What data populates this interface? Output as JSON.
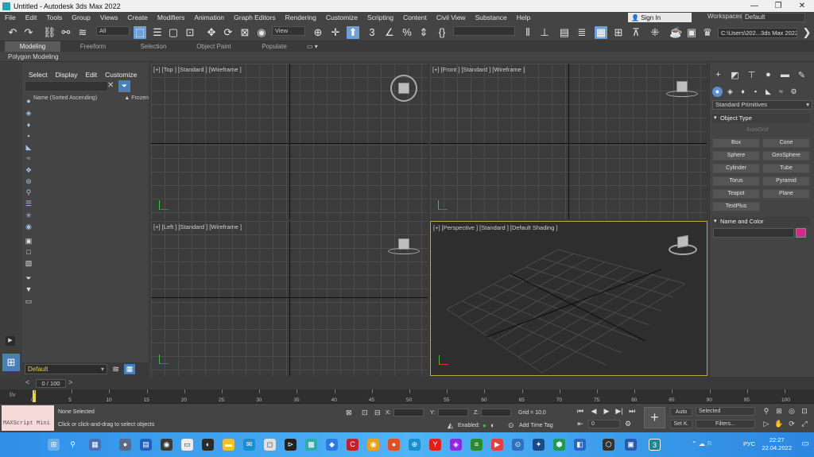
{
  "window": {
    "title": "Untitled - Autodesk 3ds Max 2022",
    "minimize": "—",
    "restore": "❐",
    "close": "✕"
  },
  "menu": [
    "File",
    "Edit",
    "Tools",
    "Group",
    "Views",
    "Create",
    "Modifiers",
    "Animation",
    "Graph Editors",
    "Rendering",
    "Customize",
    "Scripting",
    "Content",
    "Civil View",
    "Substance",
    "Help"
  ],
  "account": {
    "signin": "Sign In",
    "workspaces_label": "Workspaces:",
    "workspace": "Default"
  },
  "toolbar": {
    "selection_filter": "All",
    "ref_coord": "View",
    "project_path": "C:\\Users\\202...3ds Max 2022"
  },
  "ribbon": {
    "tabs": [
      "Modeling",
      "Freeform",
      "Selection",
      "Object Paint",
      "Populate"
    ],
    "active_tab": "Modeling",
    "sub": "Polygon Modeling"
  },
  "scene_explorer": {
    "menus": [
      "Select",
      "Display",
      "Edit",
      "Customize"
    ],
    "col_name": "Name (Sorted Ascending)",
    "col_frozen": "▲ Frozen"
  },
  "layer": "Default",
  "viewports": {
    "top": "[+] [Top ] [Standard ] [Wireframe ]",
    "front": "[+] [Front ] [Standard ] [Wireframe ]",
    "left": "[+] [Left ] [Standard ] [Wireframe ]",
    "perspective": "[+] [Perspective ] [Standard ] [Default Shading ]"
  },
  "command_panel": {
    "category": "Standard Primitives",
    "object_type": "Object Type",
    "autogrid": "AutoGrid",
    "primitives": [
      "Box",
      "Cone",
      "Sphere",
      "GeoSphere",
      "Cylinder",
      "Tube",
      "Torus",
      "Pyramid",
      "Teapot",
      "Plane",
      "TextPlus"
    ],
    "name_color": "Name and Color",
    "object_color": "#d12b8a"
  },
  "time_slider": {
    "frame": "0 / 100",
    "prev": "<",
    "next": ">"
  },
  "timeline_ticks": [
    "0",
    "5",
    "10",
    "15",
    "20",
    "25",
    "30",
    "35",
    "40",
    "45",
    "50",
    "55",
    "60",
    "65",
    "70",
    "75",
    "80",
    "85",
    "90",
    "95",
    "100"
  ],
  "status": {
    "maxscript": "MAXScript Mini",
    "selection": "None Selected",
    "prompt": "Click or click-and-drag to select objects",
    "x": "X:",
    "y": "Y:",
    "z": "Z:",
    "grid": "Grid = 10,0",
    "enabled": "Enabled:",
    "add_time_tag": "Add Time Tag",
    "auto": "Auto",
    "setk": "Set K.",
    "selected": "Selected",
    "filters": "Filters...",
    "frame_field": "0"
  },
  "taskbar": {
    "time": "22:27",
    "date": "22.04.2022",
    "lang": "РУС"
  }
}
